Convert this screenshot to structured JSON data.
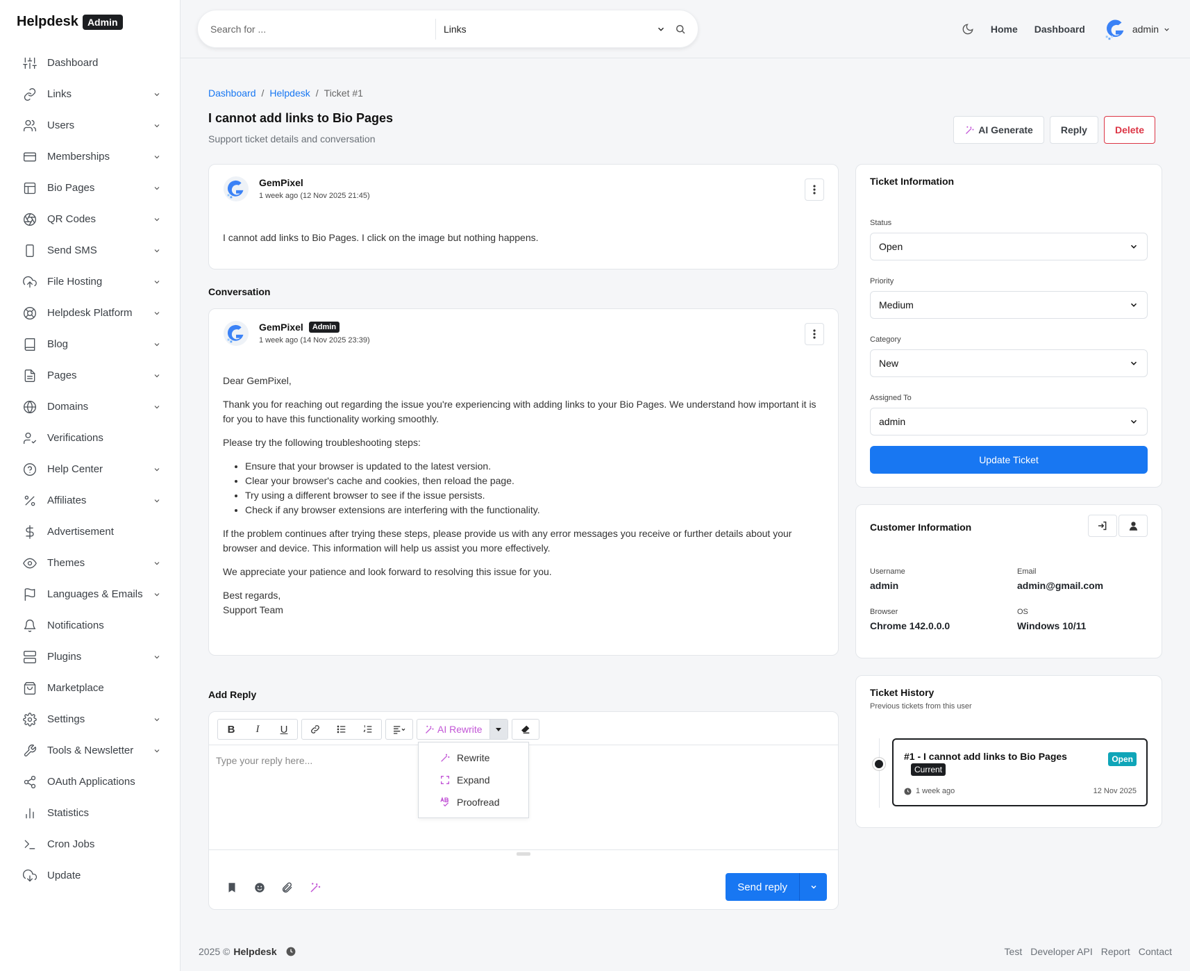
{
  "brand": {
    "name": "Helpdesk",
    "badge": "Admin"
  },
  "sidebar": {
    "items": [
      {
        "label": "Dashboard",
        "icon": "sliders-icon",
        "has_children": false
      },
      {
        "label": "Links",
        "icon": "link-icon",
        "has_children": true
      },
      {
        "label": "Users",
        "icon": "users-icon",
        "has_children": true
      },
      {
        "label": "Memberships",
        "icon": "credit-card-icon",
        "has_children": true
      },
      {
        "label": "Bio Pages",
        "icon": "layout-icon",
        "has_children": true
      },
      {
        "label": "QR Codes",
        "icon": "aperture-icon",
        "has_children": true
      },
      {
        "label": "Send SMS",
        "icon": "smartphone-icon",
        "has_children": true
      },
      {
        "label": "File Hosting",
        "icon": "upload-cloud-icon",
        "has_children": true
      },
      {
        "label": "Helpdesk Platform",
        "icon": "lifebuoy-icon",
        "has_children": true
      },
      {
        "label": "Blog",
        "icon": "book-icon",
        "has_children": true
      },
      {
        "label": "Pages",
        "icon": "file-text-icon",
        "has_children": true
      },
      {
        "label": "Domains",
        "icon": "globe-icon",
        "has_children": true
      },
      {
        "label": "Verifications",
        "icon": "user-check-icon",
        "has_children": false
      },
      {
        "label": "Help Center",
        "icon": "help-circle-icon",
        "has_children": true
      },
      {
        "label": "Affiliates",
        "icon": "percent-icon",
        "has_children": true
      },
      {
        "label": "Advertisement",
        "icon": "dollar-icon",
        "has_children": false
      },
      {
        "label": "Themes",
        "icon": "eye-icon",
        "has_children": true
      },
      {
        "label": "Languages & Emails",
        "icon": "flag-icon",
        "has_children": true
      },
      {
        "label": "Notifications",
        "icon": "bell-icon",
        "has_children": false
      },
      {
        "label": "Plugins",
        "icon": "server-icon",
        "has_children": true
      },
      {
        "label": "Marketplace",
        "icon": "shopping-bag-icon",
        "has_children": false
      },
      {
        "label": "Settings",
        "icon": "gear-icon",
        "has_children": true
      },
      {
        "label": "Tools & Newsletter",
        "icon": "tool-icon",
        "has_children": true
      },
      {
        "label": "OAuth Applications",
        "icon": "share-icon",
        "has_children": false
      },
      {
        "label": "Statistics",
        "icon": "bar-chart-icon",
        "has_children": false
      },
      {
        "label": "Cron Jobs",
        "icon": "terminal-icon",
        "has_children": false
      },
      {
        "label": "Update",
        "icon": "download-cloud-icon",
        "has_children": false
      }
    ]
  },
  "topbar": {
    "search_placeholder": "Search for ...",
    "search_scope": "Links",
    "links": [
      "Home",
      "Dashboard"
    ],
    "user": "admin"
  },
  "breadcrumb": {
    "items": [
      "Dashboard",
      "Helpdesk"
    ],
    "current": "Ticket #1"
  },
  "page": {
    "title": "I cannot add links to Bio Pages",
    "subtitle": "Support ticket details and conversation",
    "actions": {
      "ai_generate": "AI Generate",
      "reply": "Reply",
      "delete": "Delete"
    }
  },
  "ticket_message": {
    "author": "GemPixel",
    "time": "1 week ago (12 Nov 2025 21:45)",
    "body": "I cannot add links to Bio Pages. I click on the image but nothing happens."
  },
  "conversation": {
    "title": "Conversation",
    "messages": [
      {
        "author": "GemPixel",
        "badge": "Admin",
        "time": "1 week ago (14 Nov 2025 23:39)",
        "greeting": "Dear GemPixel,",
        "p1": "Thank you for reaching out regarding the issue you're experiencing with adding links to your Bio Pages. We understand how important it is for you to have this functionality working smoothly.",
        "p2": "Please try the following troubleshooting steps:",
        "steps": [
          "Ensure that your browser is updated to the latest version.",
          "Clear your browser's cache and cookies, then reload the page.",
          "Try using a different browser to see if the issue persists.",
          "Check if any browser extensions are interfering with the functionality."
        ],
        "p3": "If the problem continues after trying these steps, please provide us with any error messages you receive or further details about your browser and device. This information will help us assist you more effectively.",
        "p4": "We appreciate your patience and look forward to resolving this issue for you.",
        "sign1": "Best regards,",
        "sign2": "Support Team"
      }
    ]
  },
  "reply": {
    "title": "Add Reply",
    "placeholder": "Type your reply here...",
    "ai_rewrite": "AI Rewrite",
    "ai_menu": [
      "Rewrite",
      "Expand",
      "Proofread"
    ],
    "send": "Send reply"
  },
  "ticket_info": {
    "title": "Ticket Information",
    "status_label": "Status",
    "status": "Open",
    "priority_label": "Priority",
    "priority": "Medium",
    "category_label": "Category",
    "category": "New",
    "assigned_label": "Assigned To",
    "assigned": "admin",
    "update": "Update Ticket"
  },
  "customer": {
    "title": "Customer Information",
    "username_label": "Username",
    "username": "admin",
    "email_label": "Email",
    "email": "admin@gmail.com",
    "browser_label": "Browser",
    "browser": "Chrome 142.0.0.0",
    "os_label": "OS",
    "os": "Windows 10/11"
  },
  "history": {
    "title": "Ticket History",
    "subtitle": "Previous tickets from this user",
    "items": [
      {
        "title": "#1 - I cannot add links to Bio Pages",
        "current": "Current",
        "status": "Open",
        "ago": "1 week ago",
        "date": "12 Nov 2025"
      }
    ]
  },
  "footer": {
    "year": "2025 ©",
    "brand": "Helpdesk",
    "links": [
      "Test",
      "Developer API",
      "Report",
      "Contact"
    ]
  },
  "colors": {
    "primary": "#1877f2",
    "danger": "#dc3545",
    "ai": "#c255d6",
    "open": "#0fa5b8",
    "dark": "#1c1e21"
  }
}
